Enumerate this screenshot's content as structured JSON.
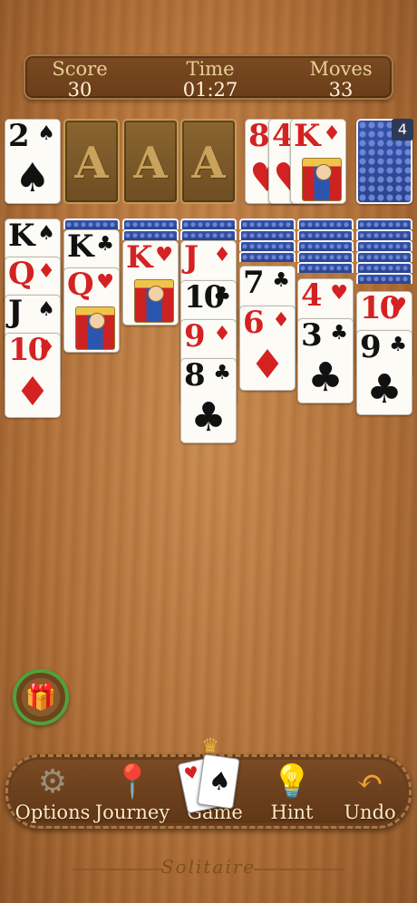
{
  "header": {
    "score_label": "Score",
    "score_value": "30",
    "time_label": "Time",
    "time_value": "01:27",
    "moves_label": "Moves",
    "moves_value": "33"
  },
  "foundations": [
    "A",
    "A",
    "A"
  ],
  "waste": [
    {
      "rank": "8",
      "suit": "♥"
    },
    {
      "rank": "4",
      "suit": "♥"
    },
    {
      "rank": "K",
      "suit": "♦"
    }
  ],
  "stock_count": "4",
  "columns": {
    "c1": [
      "K",
      "Q",
      "J",
      "10"
    ],
    "c2": [
      "K",
      "Q"
    ],
    "c3": [
      "K"
    ],
    "c4": [
      "J",
      "10",
      "9",
      "8"
    ],
    "c5": [
      "7",
      "6"
    ],
    "c6": [
      "4",
      "3"
    ],
    "c7": [
      "10",
      "9"
    ]
  },
  "suits": {
    "c1": [
      "♠",
      "♦",
      "♠",
      "♦"
    ],
    "c2": [
      "♣",
      "♥"
    ],
    "c3": [
      "♥"
    ],
    "c4": [
      "♦",
      "♣",
      "♦",
      "♣"
    ],
    "c5": [
      "♣",
      "♦"
    ],
    "c6": [
      "♥",
      "♣"
    ],
    "c7": [
      "♥",
      "♣"
    ]
  },
  "toolbar": {
    "options": "Options",
    "journey": "Journey",
    "game": "Game",
    "hint": "Hint",
    "undo": "Undo"
  },
  "icons": {
    "options": "gear-icon",
    "journey": "map-pin-icon",
    "game": "cards-icon",
    "hint": "lightbulb-icon",
    "undo": "undo-arrow-icon",
    "gift": "gift-icon"
  },
  "footer_text": "Solitaire"
}
